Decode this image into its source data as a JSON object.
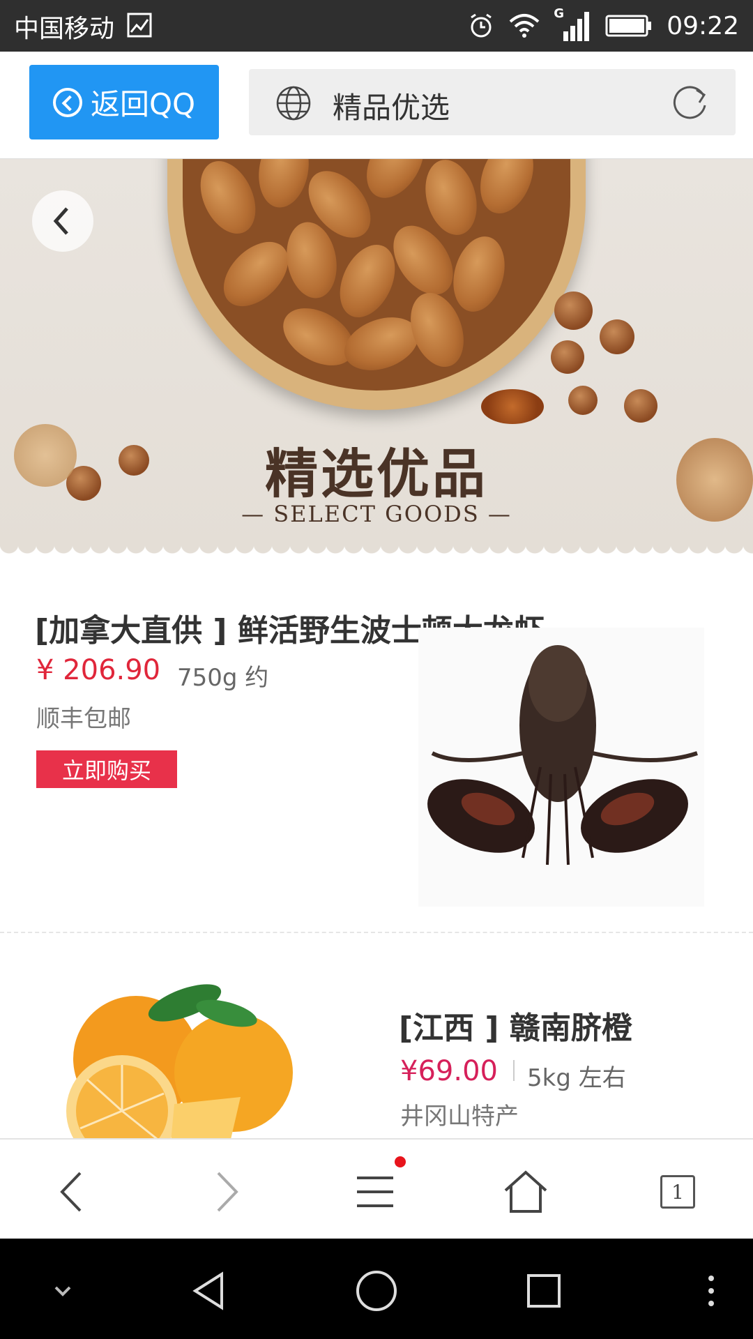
{
  "status_bar": {
    "carrier": "中国移动",
    "network": "G",
    "time": "09:22"
  },
  "address_bar": {
    "back_label": "返回QQ",
    "url_text": "精品优选"
  },
  "banner": {
    "title": "精选优品",
    "subtitle": "— SELECT GOODS —"
  },
  "products": [
    {
      "title": "[加拿大直供 ] 鲜活野生波士顿大龙虾",
      "price": "¥ 206.90",
      "weight": "750g 约",
      "note": "顺丰包邮",
      "buy_label": "立即购买"
    },
    {
      "title": "[江西 ] 赣南脐橙",
      "price": "¥69.00",
      "weight": "5kg 左右",
      "note": "井冈山特产"
    }
  ],
  "toolbar": {
    "tab_count": "1"
  },
  "colors": {
    "accent_blue": "#2196f3",
    "price_red": "#e0263a",
    "buy_red": "#e8314a"
  }
}
